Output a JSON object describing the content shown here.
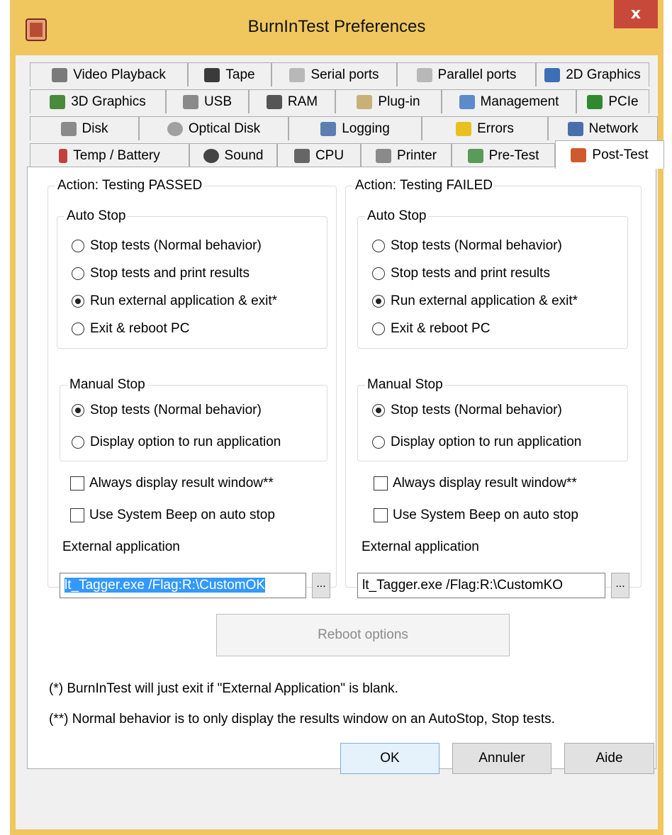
{
  "window": {
    "title": "BurnInTest Preferences",
    "close_glyph": "x"
  },
  "tabs": {
    "row1": [
      {
        "label": "Video Playback",
        "icon": "video-playback-icon",
        "color": "#7a7a7a"
      },
      {
        "label": "Tape",
        "icon": "tape-icon",
        "color": "#3a3a3a"
      },
      {
        "label": "Serial ports",
        "icon": "serial-port-icon",
        "color": "#b8b8b8"
      },
      {
        "label": "Parallel ports",
        "icon": "parallel-port-icon",
        "color": "#b8b8b8"
      },
      {
        "label": "2D Graphics",
        "icon": "monitor-icon",
        "color": "#3d6fb6"
      }
    ],
    "row2": [
      {
        "label": "3D Graphics",
        "icon": "3d-graphics-icon",
        "color": "#4a8a3b"
      },
      {
        "label": "USB",
        "icon": "usb-icon",
        "color": "#8a8a8a"
      },
      {
        "label": "RAM",
        "icon": "ram-icon",
        "color": "#555555"
      },
      {
        "label": "Plug-in",
        "icon": "plugin-icon",
        "color": "#c8b078"
      },
      {
        "label": "Management",
        "icon": "management-icon",
        "color": "#5b8bc9"
      },
      {
        "label": "PCIe",
        "icon": "pcie-icon",
        "color": "#2f8a2f"
      }
    ],
    "row3": [
      {
        "label": "Disk",
        "icon": "disk-icon",
        "color": "#8a8a8a"
      },
      {
        "label": "Optical Disk",
        "icon": "optical-disk-icon",
        "color": "#a0a0a0"
      },
      {
        "label": "Logging",
        "icon": "logging-icon",
        "color": "#5a7fb0"
      },
      {
        "label": "Errors",
        "icon": "warning-icon",
        "color": "#e8c020"
      },
      {
        "label": "Network",
        "icon": "network-icon",
        "color": "#4a6fa8"
      }
    ],
    "row4": [
      {
        "label": "Temp / Battery",
        "icon": "thermometer-icon",
        "color": "#c04040"
      },
      {
        "label": "Sound",
        "icon": "speaker-icon",
        "color": "#444444"
      },
      {
        "label": "CPU",
        "icon": "cpu-icon",
        "color": "#666666"
      },
      {
        "label": "Printer",
        "icon": "printer-icon",
        "color": "#8a8a8a"
      },
      {
        "label": "Pre-Test",
        "icon": "pre-test-icon",
        "color": "#5a9a5a"
      },
      {
        "label": "Post-Test",
        "icon": "post-test-icon",
        "color": "#d05a30",
        "active": true
      }
    ]
  },
  "passed": {
    "heading": "Action: Testing PASSED",
    "auto_stop": {
      "label": "Auto Stop",
      "options": [
        "Stop tests (Normal behavior)",
        "Stop tests and print results",
        "Run external application & exit*",
        "Exit & reboot PC"
      ],
      "selected_index": 2
    },
    "manual_stop": {
      "label": "Manual Stop",
      "options": [
        "Stop tests (Normal behavior)",
        "Display option to run application"
      ],
      "selected_index": 0
    },
    "always_display": {
      "label": "Always display result window**",
      "checked": false
    },
    "system_beep": {
      "label": "Use System Beep on auto stop",
      "checked": false
    },
    "external_label": "External application",
    "external_value": "lt_Tagger.exe /Flag:R:\\CustomOK",
    "browse": "..."
  },
  "failed": {
    "heading": "Action: Testing FAILED",
    "auto_stop": {
      "label": "Auto Stop",
      "options": [
        "Stop tests (Normal behavior)",
        "Stop tests and print results",
        "Run external application & exit*",
        "Exit & reboot PC"
      ],
      "selected_index": 2
    },
    "manual_stop": {
      "label": "Manual Stop",
      "options": [
        "Stop tests (Normal behavior)",
        "Display option to run application"
      ],
      "selected_index": 0
    },
    "always_display": {
      "label": "Always display result window**",
      "checked": false
    },
    "system_beep": {
      "label": "Use System Beep on auto stop",
      "checked": false
    },
    "external_label": "External application",
    "external_value": "lt_Tagger.exe /Flag:R:\\CustomKO",
    "browse": "..."
  },
  "reboot_options": "Reboot options",
  "notes": [
    "(*) BurnInTest will just exit if \"External Application\" is blank.",
    "(**) Normal behavior is to only display the results window on an AutoStop, Stop tests."
  ],
  "buttons": {
    "ok": "OK",
    "cancel": "Annuler",
    "help": "Aide"
  }
}
